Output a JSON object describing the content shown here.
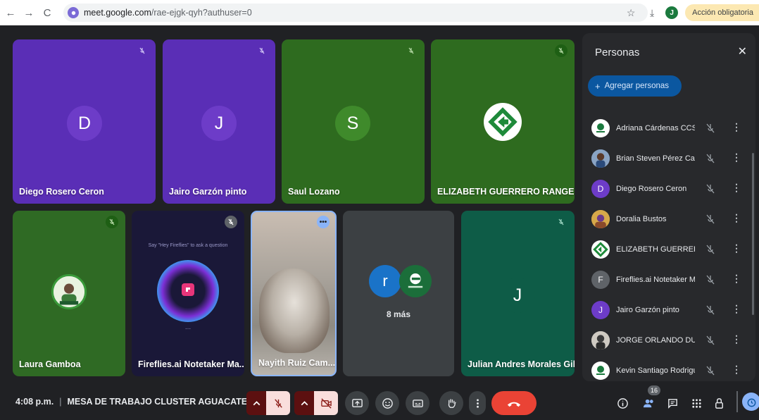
{
  "browser": {
    "url_domain": "meet.google.com",
    "url_path": "/rae-ejgk-qyh?authuser=0",
    "profile_initial": "J",
    "action_chip": "Acción obligatoria"
  },
  "tiles": [
    {
      "name": "Diego Rosero Ceron",
      "initial": "D"
    },
    {
      "name": "Jairo Garzón pinto",
      "initial": "J"
    },
    {
      "name": "Saul Lozano",
      "initial": "S"
    },
    {
      "name": "ELIZABETH GUERRERO RANGEL"
    },
    {
      "name": "Laura Gamboa"
    },
    {
      "name": "Fireflies.ai Notetaker Ma...",
      "prompt": "Say \"Hey Fireflies\" to ask a question",
      "dots": "..."
    },
    {
      "name": "Nayith Ruiz Cam..."
    },
    {
      "name": "",
      "initial": "r",
      "more": "8 más"
    },
    {
      "name": "Julian Andres Morales Gil",
      "initial": "J"
    }
  ],
  "panel": {
    "title": "Personas",
    "add_label": "Agregar personas",
    "people": [
      {
        "name": "Adriana Cárdenas CCSu...",
        "avatar": "logo"
      },
      {
        "name": "Brian Steven Pérez Cam...",
        "avatar": "photo"
      },
      {
        "name": "Diego Rosero Ceron",
        "initial": "D"
      },
      {
        "name": "Doralia Bustos",
        "avatar": "photo"
      },
      {
        "name": "ELIZABETH GUERRERO ...",
        "avatar": "logo"
      },
      {
        "name": "Fireflies.ai Notetaker M...",
        "initial": "F"
      },
      {
        "name": "Jairo Garzón pinto",
        "initial": "J"
      },
      {
        "name": "JORGE ORLANDO DUR...",
        "avatar": "photo"
      },
      {
        "name": "Kevin Santiago Rodriguez",
        "avatar": "logo"
      }
    ]
  },
  "bottom": {
    "time": "4:08 p.m.",
    "meeting": "MESA DE TRABAJO CLUSTER AGUACATE - C...",
    "participant_count": "16"
  },
  "colors": {
    "tile_purple": "#5a2eb6",
    "tile_green": "#2e6b1f",
    "tile_dark_green": "#0e5c47",
    "leave_red": "#ea4335"
  }
}
